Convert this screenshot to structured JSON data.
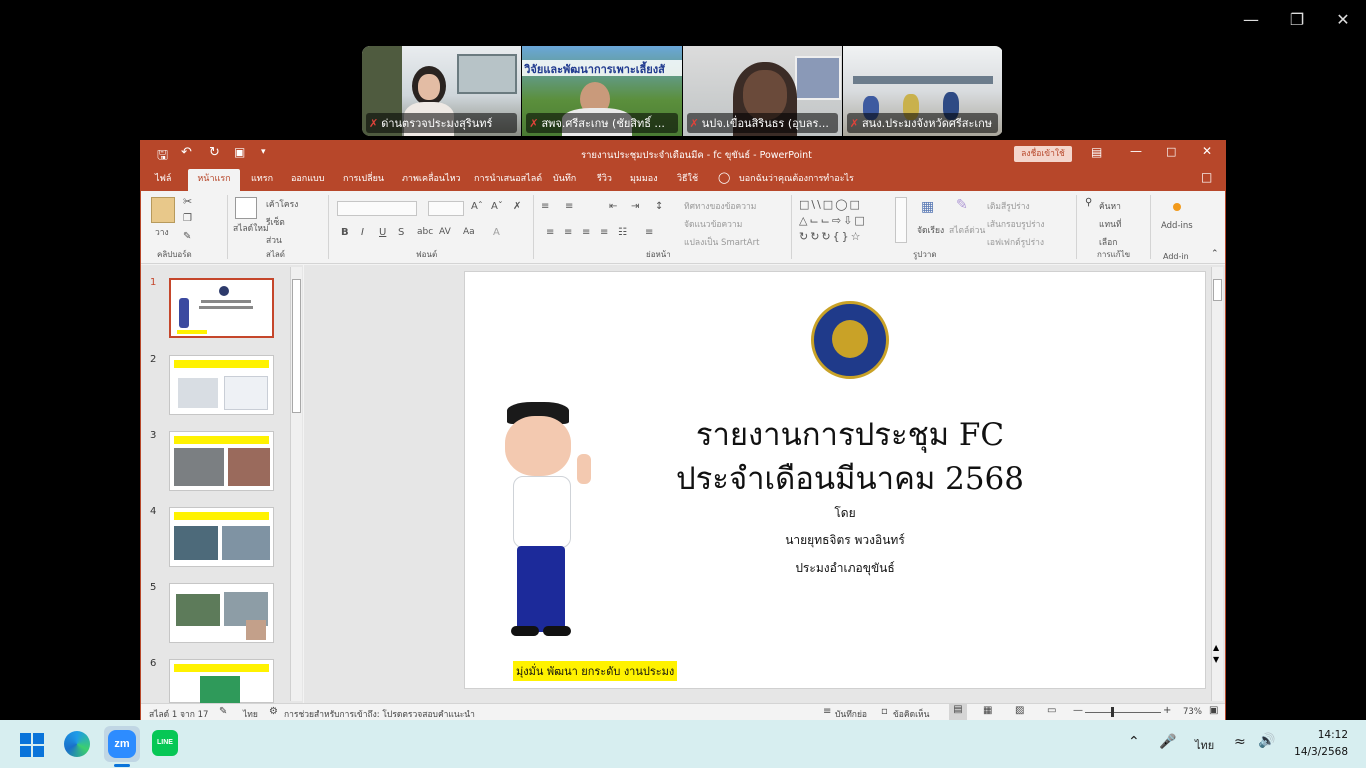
{
  "ppt": {
    "title": "รายงานประชุมประจำเดือนมีค - fc ขุขันธ์ - PowerPoint",
    "signin": "ลงชื่อเข้าใช้",
    "tabs": [
      "ไฟล์",
      "หน้าแรก",
      "แทรก",
      "ออกแบบ",
      "การเปลี่ยน",
      "ภาพเคลื่อนไหว",
      "การนำเสนอสไลด์",
      "บันทึก",
      "รีวิว",
      "มุมมอง",
      "วิธีใช้"
    ],
    "tell_me": "บอกฉันว่าคุณต้องการทำอะไร",
    "ribbon": {
      "groups": [
        "คลิปบอร์ด",
        "สไลด์",
        "ฟอนต์",
        "ย่อหน้า",
        "รูปวาด",
        "การแก้ไข",
        "Add-in"
      ],
      "paste": "วาง",
      "new_slide": "สไลด์ใหม่",
      "layout": "เค้าโครง",
      "reset": "รีเซ็ต",
      "section": "ส่วน",
      "text_direction": "ทิศทางของข้อความ",
      "align_text": "จัดแนวข้อความ",
      "smartart": "แปลงเป็น SmartArt",
      "arrange": "จัดเรียง",
      "quick_styles": "สไตล์ด่วน",
      "shape_fill": "เติมสีรูปร่าง",
      "shape_outline": "เส้นกรอบรูปร่าง",
      "shape_effects": "เอฟเฟกต์รูปร่าง",
      "find": "ค้นหา",
      "replace": "แทนที่",
      "select": "เลือก",
      "addins": "Add-ins"
    },
    "slide": {
      "title_line1": "รายงานการประชุม FC",
      "title_line2": "ประจำเดือนมีนาคม 2568",
      "by": "โดย",
      "name": "นายยุทธจิตร พวงอินทร์",
      "position": "ประมงอำเภอขุขันธ์",
      "slogan": "มุ่งมั่น พัฒนา ยกระดับ งานประมง"
    },
    "thumbnails": [
      "1",
      "2",
      "3",
      "4",
      "5",
      "6"
    ],
    "status": {
      "slide_count": "สไลด์ 1 จาก 17",
      "lang": "ไทย",
      "accessibility": "การช่วยสำหรับการเข้าถึง: โปรดตรวจสอบคำแนะนำ",
      "notes": "บันทึกย่อ",
      "comments": "ข้อคิดเห็น",
      "zoom": "73%"
    }
  },
  "video_tiles": [
    {
      "name": "ด่านตรวจประมงสุรินทร์"
    },
    {
      "name": "สพจ.ศรีสะเกษ (ชัยสิทธิ์ ..."
    },
    {
      "name": "นปจ.เขื่อนสิรินธร (อุบลร..."
    },
    {
      "name": "สนง.ประมงจังหวัดศรีสะเกษ"
    }
  ],
  "tile1_banner": "วิจัยและพัฒนาการเพาะเลี้ยงสั",
  "taskbar": {
    "lang": "ไทย",
    "time": "14:12",
    "date": "14/3/2568"
  },
  "colors": {
    "ppt_accent": "#b7472a",
    "taskbar": "#d7eef0"
  }
}
